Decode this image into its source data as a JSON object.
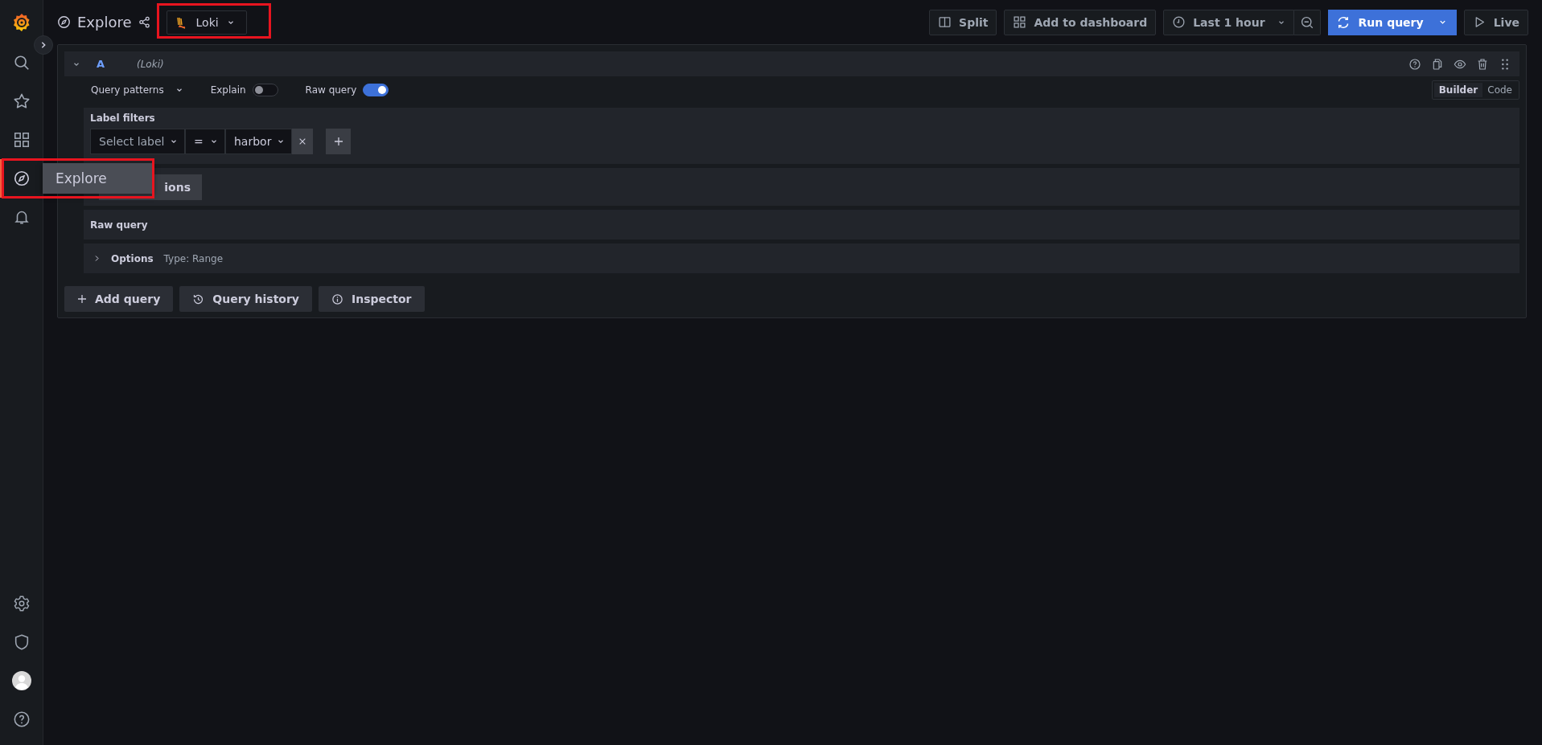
{
  "sidebar": {
    "items": [
      {
        "kind": "search",
        "selected": false
      },
      {
        "kind": "starred",
        "selected": false
      },
      {
        "kind": "dashboards",
        "selected": false
      },
      {
        "kind": "explore",
        "selected": true
      },
      {
        "kind": "alerting",
        "selected": false
      }
    ],
    "bottom_items": [
      {
        "kind": "settings",
        "selected": false
      },
      {
        "kind": "shield",
        "selected": false
      },
      {
        "kind": "profile",
        "selected": false
      },
      {
        "kind": "help",
        "selected": false
      }
    ],
    "tooltip": {
      "text": "Explore",
      "highlighted": true
    }
  },
  "header": {
    "title": "Explore",
    "datasource": {
      "name": "Loki",
      "highlighted": true
    },
    "actions": [
      {
        "kind": "split",
        "label": "Split"
      },
      {
        "kind": "add",
        "label": "Add to dashboard"
      },
      {
        "kind": "time",
        "label": "Last 1 hour"
      },
      {
        "kind": "run",
        "label": "Run query"
      },
      {
        "kind": "live",
        "label": "Live"
      }
    ]
  },
  "query": {
    "ref": "A",
    "datasource": "(Loki)",
    "query_patterns": "Query patterns",
    "explain": {
      "label": "Explain",
      "on": false
    },
    "raw_query_toggle": {
      "label": "Raw query",
      "on": true
    },
    "editor_modes": [
      {
        "label": "Builder",
        "selected": true
      },
      {
        "label": "Code",
        "selected": false
      }
    ],
    "label_filters": {
      "title": "Label filters",
      "label_placeholder": "Select label",
      "operator": "=",
      "value": "harbor"
    },
    "operations_button": "ions",
    "raw_query_title": "Raw query",
    "options": {
      "title": "Options",
      "summary": "Type: Range"
    }
  },
  "footer_buttons": [
    {
      "kind": "add",
      "label": "Add query"
    },
    {
      "kind": "history",
      "label": "Query history"
    },
    {
      "kind": "inspector",
      "label": "Inspector"
    }
  ]
}
